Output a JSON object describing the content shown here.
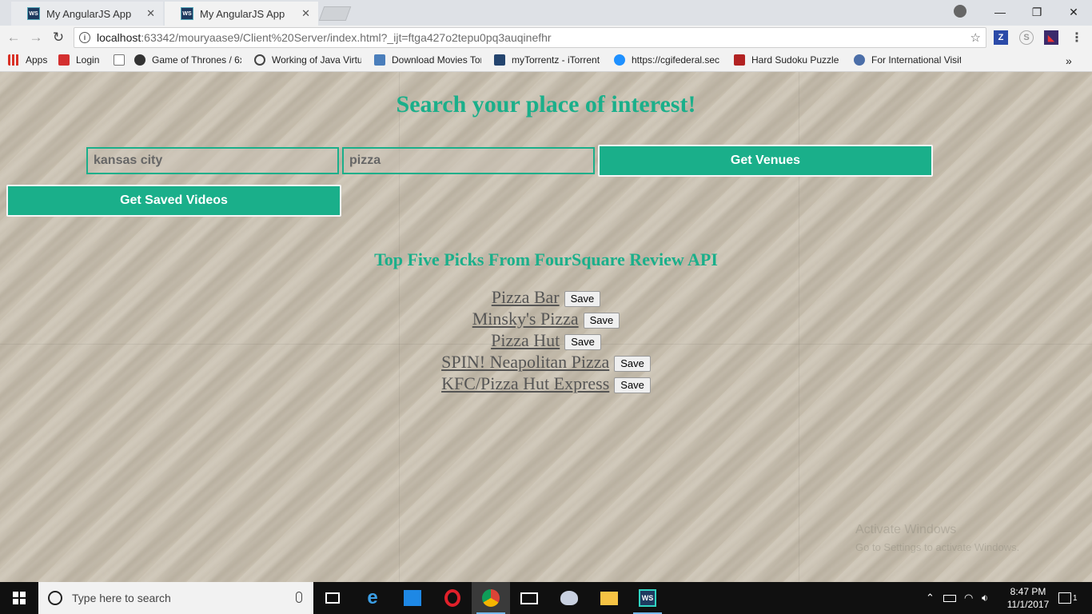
{
  "browser": {
    "tabs": [
      {
        "label": "My AngularJS App",
        "favicon": "WS"
      },
      {
        "label": "My AngularJS App",
        "favicon": "WS"
      }
    ],
    "url_host": "localhost",
    "url_path": ":63342/mouryaase9/Client%20Server/index.html?_ijt=ftga427o2tepu0pq3auqinefhr",
    "bookmarks": [
      {
        "label": "Apps",
        "icon": "apps-grid-icon",
        "color": "#d93025"
      },
      {
        "label": "Login",
        "icon": "aci-icon",
        "color": "#d32f2f"
      },
      {
        "label": "",
        "icon": "page-icon",
        "color": "#ffffff"
      },
      {
        "label": "Game of Thrones / 6x",
        "icon": "binoculars-icon",
        "color": "#333333"
      },
      {
        "label": "Working of Java Virtu",
        "icon": "g-icon",
        "color": "#444444"
      },
      {
        "label": "Download Movies Tor",
        "icon": "download-icon",
        "color": "#4a7ebb"
      },
      {
        "label": "myTorrentz - iTorrent",
        "icon": "t-icon",
        "color": "#23446e"
      },
      {
        "label": "https://cgifederal.sec",
        "icon": "cloud-icon",
        "color": "#1e90ff"
      },
      {
        "label": "Hard Sudoku Puzzle",
        "icon": "sudoku-icon",
        "color": "#b22222"
      },
      {
        "label": "For International Visit",
        "icon": "seal-icon",
        "color": "#4b6ea8"
      }
    ],
    "more_label": "»"
  },
  "page": {
    "title": "Search your place of interest!",
    "city_value": "kansas city",
    "query_value": "pizza",
    "get_venues_label": "Get Venues",
    "get_saved_label": "Get Saved Videos",
    "section_title": "Top Five Picks From FourSquare Review API",
    "save_label": "Save",
    "venues": [
      "Pizza Bar",
      "Minsky's Pizza",
      "Pizza Hut",
      "SPIN! Neapolitan Pizza",
      "KFC/Pizza Hut Express"
    ],
    "watermark_line1": "Activate Windows",
    "watermark_line2": "Go to Settings to activate Windows."
  },
  "taskbar": {
    "search_placeholder": "Type here to search",
    "time": "8:47 PM",
    "date": "11/1/2017",
    "notification_count": "1"
  },
  "colors": {
    "accent": "#1aaf8a",
    "sand": "#c8bfae"
  }
}
